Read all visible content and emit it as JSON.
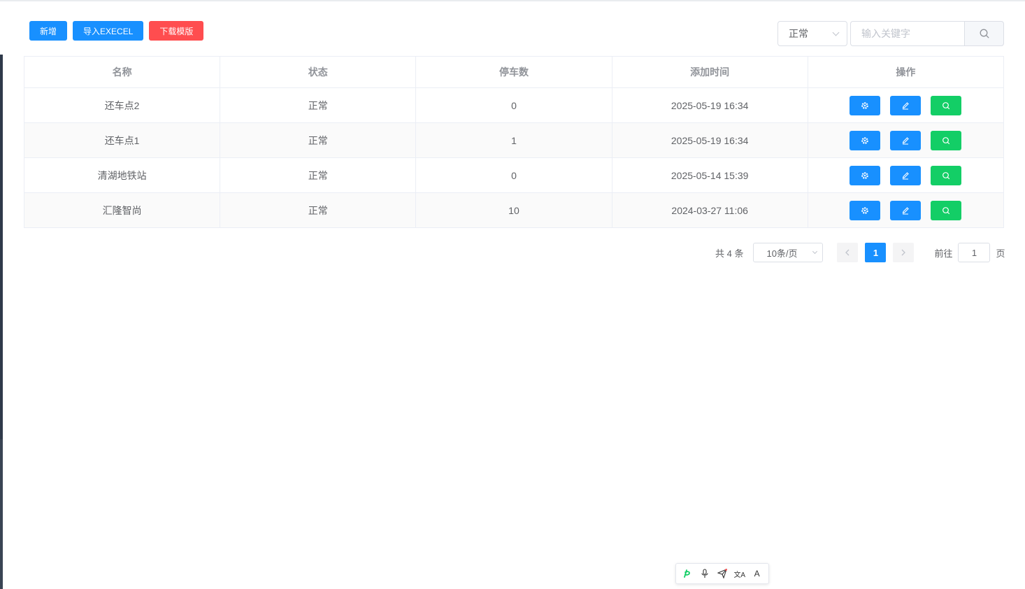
{
  "toolbar": {
    "add_label": "新增",
    "import_label": "导入EXECEL",
    "download_label": "下载模版"
  },
  "filter": {
    "status_selected": "正常",
    "search_placeholder": "输入关键字"
  },
  "table": {
    "headers": [
      "名称",
      "状态",
      "停车数",
      "添加时间",
      "操作"
    ],
    "rows": [
      {
        "name": "还车点2",
        "status": "正常",
        "count": "0",
        "time": "2025-05-19 16:34"
      },
      {
        "name": "还车点1",
        "status": "正常",
        "count": "1",
        "time": "2025-05-19 16:34"
      },
      {
        "name": "清湖地铁站",
        "status": "正常",
        "count": "0",
        "time": "2025-05-14 15:39"
      },
      {
        "name": "汇隆智尚",
        "status": "正常",
        "count": "10",
        "time": "2024-03-27 11:06"
      }
    ]
  },
  "pagination": {
    "total": "共 4 条",
    "page_size": "10条/页",
    "current_page": "1",
    "goto_prefix": "前往",
    "goto_value": "1",
    "goto_suffix": "页"
  },
  "float_bar": {
    "translate_glyph": "文A",
    "text_glyph": "A"
  },
  "colors": {
    "primary": "#1890ff",
    "danger": "#ff4d4f",
    "success": "#13ce66"
  }
}
